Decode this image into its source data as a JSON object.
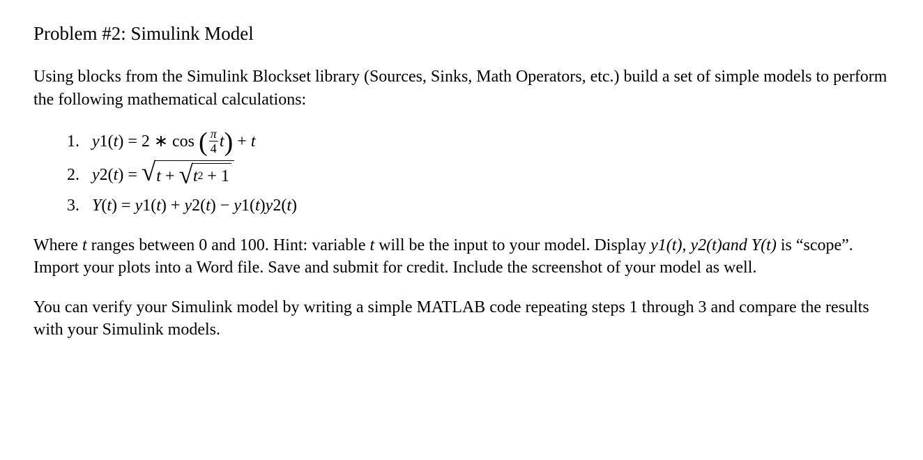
{
  "title": "Problem #2: Simulink Model",
  "intro": "Using blocks from the Simulink Blockset library (Sources, Sinks, Math Operators, etc.) build a set of simple models to perform the following mathematical calculations:",
  "equations": {
    "items": [
      {
        "num": "1.",
        "lhs_var": "y",
        "lhs_sub": "1",
        "lhs_arg": "t",
        "coef": "2",
        "op_cos": "cos",
        "frac_num": "π",
        "frac_den": "4",
        "inner_var": "t",
        "plus": "+",
        "tail_var": "t",
        "equals": "="
      },
      {
        "num": "2.",
        "lhs_var": "y",
        "lhs_sub": "2",
        "lhs_arg": "t",
        "equals": "=",
        "outer_t": "t",
        "plus1": "+",
        "inner_t": "t",
        "sq": "2",
        "plus2": "+",
        "one": "1"
      },
      {
        "num": "3.",
        "Y": "Y",
        "arg": "t",
        "equals": "=",
        "y1": "y",
        "sub1": "1",
        "y2": "y",
        "sub2": "2",
        "plus": "+",
        "minus": "−"
      }
    ]
  },
  "where_pre": "Where ",
  "where_var_t": "t",
  "where_mid1": " ranges between 0 and 100. Hint: variable ",
  "where_mid2": " will be the input to your model. Display ",
  "disp_y1": "y1(t), y2(t) and Y(t)",
  "where_mid3": " is “scope”. Import your plots into a Word file. Save and submit for credit. Include the screenshot of your model as well.",
  "verify": "You can verify your Simulink model by writing a simple MATLAB code repeating steps 1 through 3 and compare the results with your Simulink models."
}
